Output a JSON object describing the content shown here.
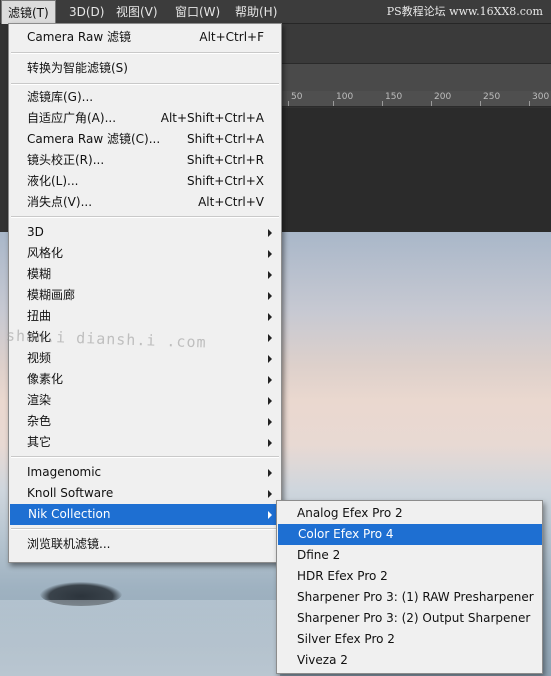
{
  "menubar": {
    "items": [
      "滤镜(T)",
      "3D(D)",
      "视图(V)",
      "窗口(W)",
      "帮助(H)"
    ],
    "watermark": "PS教程论坛 www.16XX8.com"
  },
  "ruler": {
    "ticks": [
      "50",
      "100",
      "150",
      "200",
      "250",
      "300"
    ]
  },
  "filter_menu": {
    "last_filter": {
      "label": "Camera Raw 滤镜",
      "shortcut": "Alt+Ctrl+F"
    },
    "convert_smart": {
      "label": "转换为智能滤镜(S)"
    },
    "group1": [
      {
        "label": "滤镜库(G)...",
        "shortcut": ""
      },
      {
        "label": "自适应广角(A)...",
        "shortcut": "Alt+Shift+Ctrl+A"
      },
      {
        "label": "Camera Raw 滤镜(C)...",
        "shortcut": "Shift+Ctrl+A"
      },
      {
        "label": "镜头校正(R)...",
        "shortcut": "Shift+Ctrl+R"
      },
      {
        "label": "液化(L)...",
        "shortcut": "Shift+Ctrl+X"
      },
      {
        "label": "消失点(V)...",
        "shortcut": "Alt+Ctrl+V"
      }
    ],
    "group2": [
      "3D",
      "风格化",
      "模糊",
      "模糊画廊",
      "扭曲",
      "锐化",
      "视频",
      "像素化",
      "渲染",
      "杂色",
      "其它"
    ],
    "group3": [
      "Imagenomic",
      "Knoll Software",
      "Nik Collection"
    ],
    "browse": {
      "label": "浏览联机滤镜..."
    },
    "highlighted": "Nik Collection",
    "watermark": "shan.i  diansh.i  .com"
  },
  "nik_submenu": {
    "items": [
      "Analog Efex Pro 2",
      "Color Efex Pro 4",
      "Dfine 2",
      "HDR Efex Pro 2",
      "Sharpener Pro 3: (1) RAW Presharpener",
      "Sharpener Pro 3: (2) Output Sharpener",
      "Silver Efex Pro 2",
      "Viveza 2"
    ],
    "highlighted": "Color Efex Pro 4"
  },
  "colors": {
    "highlight": "#1e6fd2",
    "menu_bg": "#f0f0f0",
    "menubar_bg": "#3c3c3c"
  }
}
